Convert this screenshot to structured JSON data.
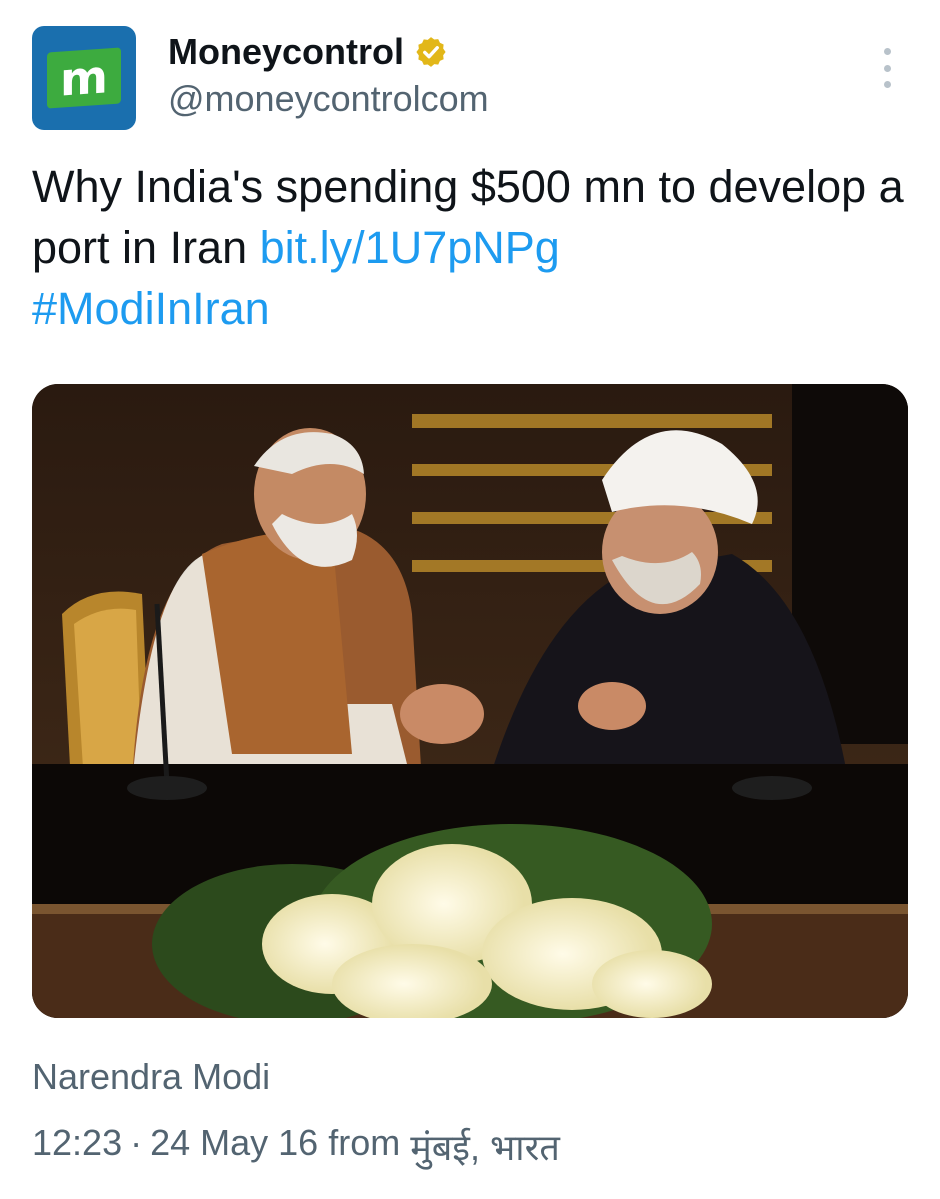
{
  "author": {
    "display_name": "Moneycontrol",
    "handle": "@moneycontrolcom",
    "avatar_letter": "m",
    "verified_icon": "verified-badge-gold",
    "verified_color": "#e2b719"
  },
  "tweet": {
    "text_line": "Why India's spending $500 mn to develop a port in Iran",
    "link": "bit.ly/1U7pNPg",
    "hashtag": "#ModiInIran",
    "link_color": "#1d9bf0"
  },
  "media": {
    "description_icon": "photo-handshake",
    "credit": "Narendra Modi"
  },
  "meta": {
    "time": "12:23",
    "separator": "·",
    "date": "24 May 16",
    "from_label": "from",
    "location": "मुंबई, भारत"
  },
  "menu": {
    "icon": "more-vertical-icon"
  }
}
